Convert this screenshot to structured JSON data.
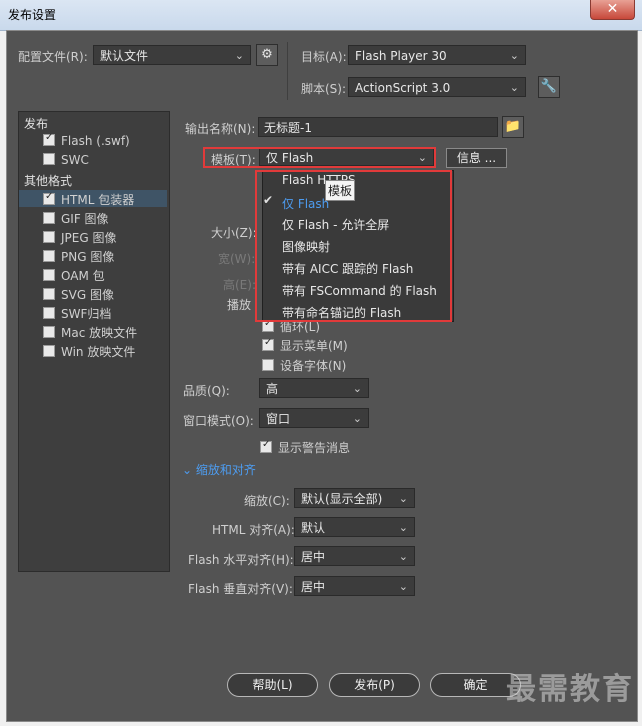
{
  "window": {
    "title": "发布设置",
    "close_glyph": "✕"
  },
  "profile": {
    "label": "配置文件(R):",
    "value": "默认文件",
    "gear_icon": "gear-icon"
  },
  "target": {
    "label": "目标(A):",
    "value": "Flash Player 30"
  },
  "script": {
    "label": "脚本(S):",
    "value": "ActionScript 3.0",
    "wrench_icon": "wrench-icon"
  },
  "left_panel": {
    "publish_header": "发布",
    "publish_items": [
      {
        "label": "Flash (.swf)",
        "checked": true
      },
      {
        "label": "SWC",
        "checked": false
      }
    ],
    "other_header": "其他格式",
    "other_items": [
      {
        "label": "HTML 包装器",
        "checked": true,
        "selected": true
      },
      {
        "label": "GIF 图像",
        "checked": false
      },
      {
        "label": "JPEG 图像",
        "checked": false
      },
      {
        "label": "PNG 图像",
        "checked": false
      },
      {
        "label": "OAM 包",
        "checked": false
      },
      {
        "label": "SVG 图像",
        "checked": false
      },
      {
        "label": "SWF归档",
        "checked": false
      },
      {
        "label": "Mac 放映文件",
        "checked": false
      },
      {
        "label": "Win 放映文件",
        "checked": false
      }
    ]
  },
  "output": {
    "label": "输出名称(N):",
    "value": "无标题-1"
  },
  "template": {
    "label": "模板(T):",
    "value": "仅 Flash",
    "info_button": "信息 ..."
  },
  "template_menu": {
    "items": [
      {
        "label": "Flash HTTPS",
        "checked": false
      },
      {
        "label": "仅 Flash",
        "checked": true
      },
      {
        "label": "仅 Flash - 允许全屏",
        "checked": false
      },
      {
        "label": "图像映射",
        "checked": false
      },
      {
        "label": "带有 AICC 跟踪的 Flash",
        "checked": false
      },
      {
        "label": "带有 FSCommand 的 Flash",
        "checked": false
      },
      {
        "label": "带有命名锚记的 Flash",
        "checked": false
      }
    ],
    "tooltip": "模板"
  },
  "hidden_labels": {
    "size": "大小(Z):",
    "width": "宽(W):",
    "height": "高(E):",
    "playback": "播放"
  },
  "playback_options": [
    {
      "label": "循环(L)",
      "checked": true
    },
    {
      "label": "显示菜单(M)",
      "checked": true
    },
    {
      "label": "设备字体(N)",
      "checked": false
    }
  ],
  "quality": {
    "label": "品质(Q):",
    "value": "高"
  },
  "window_mode": {
    "label": "窗口模式(O):",
    "value": "窗口"
  },
  "show_warnings": {
    "label": "显示警告消息",
    "checked": true
  },
  "scale_section": {
    "label": "缩放和对齐"
  },
  "scale": {
    "label": "缩放(C):",
    "value": "默认(显示全部)"
  },
  "html_align": {
    "label": "HTML 对齐(A):",
    "value": "默认"
  },
  "flash_h_align": {
    "label": "Flash 水平对齐(H):",
    "value": "居中"
  },
  "flash_v_align": {
    "label": "Flash 垂直对齐(V):",
    "value": "居中"
  },
  "buttons": {
    "help": "帮助(L)",
    "publish": "发布(P)",
    "ok": "确定"
  },
  "watermark": "最需教育",
  "colors": {
    "highlight_box": "#e13a3a",
    "selection": "#3f5466",
    "link": "#4d9cf0"
  }
}
